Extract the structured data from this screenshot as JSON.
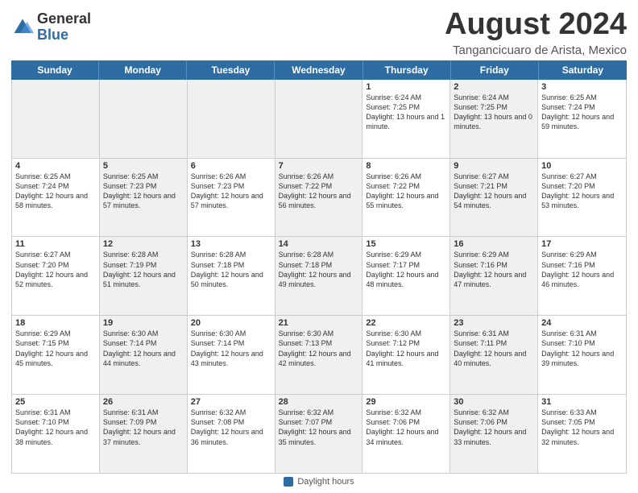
{
  "logo": {
    "general": "General",
    "blue": "Blue"
  },
  "title": "August 2024",
  "subtitle": "Tangancicuaro de Arista, Mexico",
  "header_days": [
    "Sunday",
    "Monday",
    "Tuesday",
    "Wednesday",
    "Thursday",
    "Friday",
    "Saturday"
  ],
  "weeks": [
    [
      {
        "day": "",
        "info": "",
        "shaded": true
      },
      {
        "day": "",
        "info": "",
        "shaded": true
      },
      {
        "day": "",
        "info": "",
        "shaded": true
      },
      {
        "day": "",
        "info": "",
        "shaded": true
      },
      {
        "day": "1",
        "info": "Sunrise: 6:24 AM\nSunset: 7:25 PM\nDaylight: 13 hours\nand 1 minute.",
        "shaded": false
      },
      {
        "day": "2",
        "info": "Sunrise: 6:24 AM\nSunset: 7:25 PM\nDaylight: 13 hours\nand 0 minutes.",
        "shaded": true
      },
      {
        "day": "3",
        "info": "Sunrise: 6:25 AM\nSunset: 7:24 PM\nDaylight: 12 hours\nand 59 minutes.",
        "shaded": false
      }
    ],
    [
      {
        "day": "4",
        "info": "Sunrise: 6:25 AM\nSunset: 7:24 PM\nDaylight: 12 hours\nand 58 minutes.",
        "shaded": false
      },
      {
        "day": "5",
        "info": "Sunrise: 6:25 AM\nSunset: 7:23 PM\nDaylight: 12 hours\nand 57 minutes.",
        "shaded": true
      },
      {
        "day": "6",
        "info": "Sunrise: 6:26 AM\nSunset: 7:23 PM\nDaylight: 12 hours\nand 57 minutes.",
        "shaded": false
      },
      {
        "day": "7",
        "info": "Sunrise: 6:26 AM\nSunset: 7:22 PM\nDaylight: 12 hours\nand 56 minutes.",
        "shaded": true
      },
      {
        "day": "8",
        "info": "Sunrise: 6:26 AM\nSunset: 7:22 PM\nDaylight: 12 hours\nand 55 minutes.",
        "shaded": false
      },
      {
        "day": "9",
        "info": "Sunrise: 6:27 AM\nSunset: 7:21 PM\nDaylight: 12 hours\nand 54 minutes.",
        "shaded": true
      },
      {
        "day": "10",
        "info": "Sunrise: 6:27 AM\nSunset: 7:20 PM\nDaylight: 12 hours\nand 53 minutes.",
        "shaded": false
      }
    ],
    [
      {
        "day": "11",
        "info": "Sunrise: 6:27 AM\nSunset: 7:20 PM\nDaylight: 12 hours\nand 52 minutes.",
        "shaded": false
      },
      {
        "day": "12",
        "info": "Sunrise: 6:28 AM\nSunset: 7:19 PM\nDaylight: 12 hours\nand 51 minutes.",
        "shaded": true
      },
      {
        "day": "13",
        "info": "Sunrise: 6:28 AM\nSunset: 7:18 PM\nDaylight: 12 hours\nand 50 minutes.",
        "shaded": false
      },
      {
        "day": "14",
        "info": "Sunrise: 6:28 AM\nSunset: 7:18 PM\nDaylight: 12 hours\nand 49 minutes.",
        "shaded": true
      },
      {
        "day": "15",
        "info": "Sunrise: 6:29 AM\nSunset: 7:17 PM\nDaylight: 12 hours\nand 48 minutes.",
        "shaded": false
      },
      {
        "day": "16",
        "info": "Sunrise: 6:29 AM\nSunset: 7:16 PM\nDaylight: 12 hours\nand 47 minutes.",
        "shaded": true
      },
      {
        "day": "17",
        "info": "Sunrise: 6:29 AM\nSunset: 7:16 PM\nDaylight: 12 hours\nand 46 minutes.",
        "shaded": false
      }
    ],
    [
      {
        "day": "18",
        "info": "Sunrise: 6:29 AM\nSunset: 7:15 PM\nDaylight: 12 hours\nand 45 minutes.",
        "shaded": false
      },
      {
        "day": "19",
        "info": "Sunrise: 6:30 AM\nSunset: 7:14 PM\nDaylight: 12 hours\nand 44 minutes.",
        "shaded": true
      },
      {
        "day": "20",
        "info": "Sunrise: 6:30 AM\nSunset: 7:14 PM\nDaylight: 12 hours\nand 43 minutes.",
        "shaded": false
      },
      {
        "day": "21",
        "info": "Sunrise: 6:30 AM\nSunset: 7:13 PM\nDaylight: 12 hours\nand 42 minutes.",
        "shaded": true
      },
      {
        "day": "22",
        "info": "Sunrise: 6:30 AM\nSunset: 7:12 PM\nDaylight: 12 hours\nand 41 minutes.",
        "shaded": false
      },
      {
        "day": "23",
        "info": "Sunrise: 6:31 AM\nSunset: 7:11 PM\nDaylight: 12 hours\nand 40 minutes.",
        "shaded": true
      },
      {
        "day": "24",
        "info": "Sunrise: 6:31 AM\nSunset: 7:10 PM\nDaylight: 12 hours\nand 39 minutes.",
        "shaded": false
      }
    ],
    [
      {
        "day": "25",
        "info": "Sunrise: 6:31 AM\nSunset: 7:10 PM\nDaylight: 12 hours\nand 38 minutes.",
        "shaded": false
      },
      {
        "day": "26",
        "info": "Sunrise: 6:31 AM\nSunset: 7:09 PM\nDaylight: 12 hours\nand 37 minutes.",
        "shaded": true
      },
      {
        "day": "27",
        "info": "Sunrise: 6:32 AM\nSunset: 7:08 PM\nDaylight: 12 hours\nand 36 minutes.",
        "shaded": false
      },
      {
        "day": "28",
        "info": "Sunrise: 6:32 AM\nSunset: 7:07 PM\nDaylight: 12 hours\nand 35 minutes.",
        "shaded": true
      },
      {
        "day": "29",
        "info": "Sunrise: 6:32 AM\nSunset: 7:06 PM\nDaylight: 12 hours\nand 34 minutes.",
        "shaded": false
      },
      {
        "day": "30",
        "info": "Sunrise: 6:32 AM\nSunset: 7:06 PM\nDaylight: 12 hours\nand 33 minutes.",
        "shaded": true
      },
      {
        "day": "31",
        "info": "Sunrise: 6:33 AM\nSunset: 7:05 PM\nDaylight: 12 hours\nand 32 minutes.",
        "shaded": false
      }
    ]
  ],
  "footer": {
    "label": "Daylight hours"
  }
}
